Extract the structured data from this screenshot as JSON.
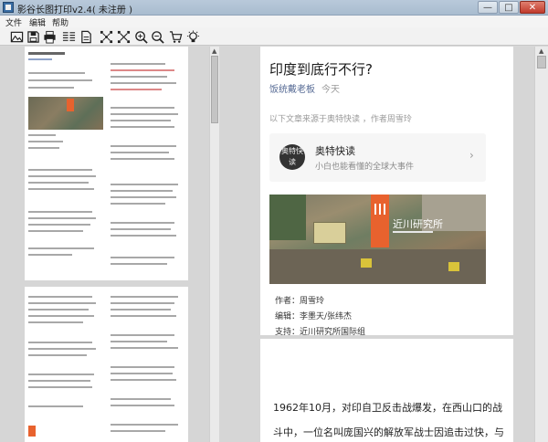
{
  "window": {
    "title": "影谷长图打印v2.4( 未注册 )",
    "min": "—",
    "max": "□",
    "close": "✕"
  },
  "menu": {
    "items": [
      "文件",
      "编辑",
      "帮助"
    ]
  },
  "toolbar": {
    "buttons": [
      "image-icon",
      "save-icon",
      "print-icon",
      "columns-icon",
      "page-icon",
      "fit-icon",
      "zoom-in-icon",
      "zoom-out-icon",
      "cart-icon",
      "lightbulb-icon"
    ]
  },
  "article": {
    "title": "印度到底行不行?",
    "author": "饭统戴老板",
    "date": "今天",
    "source_line": "以下文章来源于奥特快读 ，作者周雪玲",
    "card": {
      "avatar": "奥特快读",
      "name": "奥特快读",
      "description": "小白也能看懂的全球大事件",
      "chevron": "›"
    },
    "image_logo_text": "近川研究所",
    "meta": [
      "作者：周雪玲",
      "编辑：李墨天/张纬杰",
      "支持：近川研究所国际组"
    ],
    "body": [
      "1962年10月，对印自卫反击战爆发，在西山口的战",
      "斗中，一位名叫庞国兴的解放军战士因追击过快，与"
    ]
  },
  "scroll": {
    "up": "▲",
    "down": "▼"
  }
}
